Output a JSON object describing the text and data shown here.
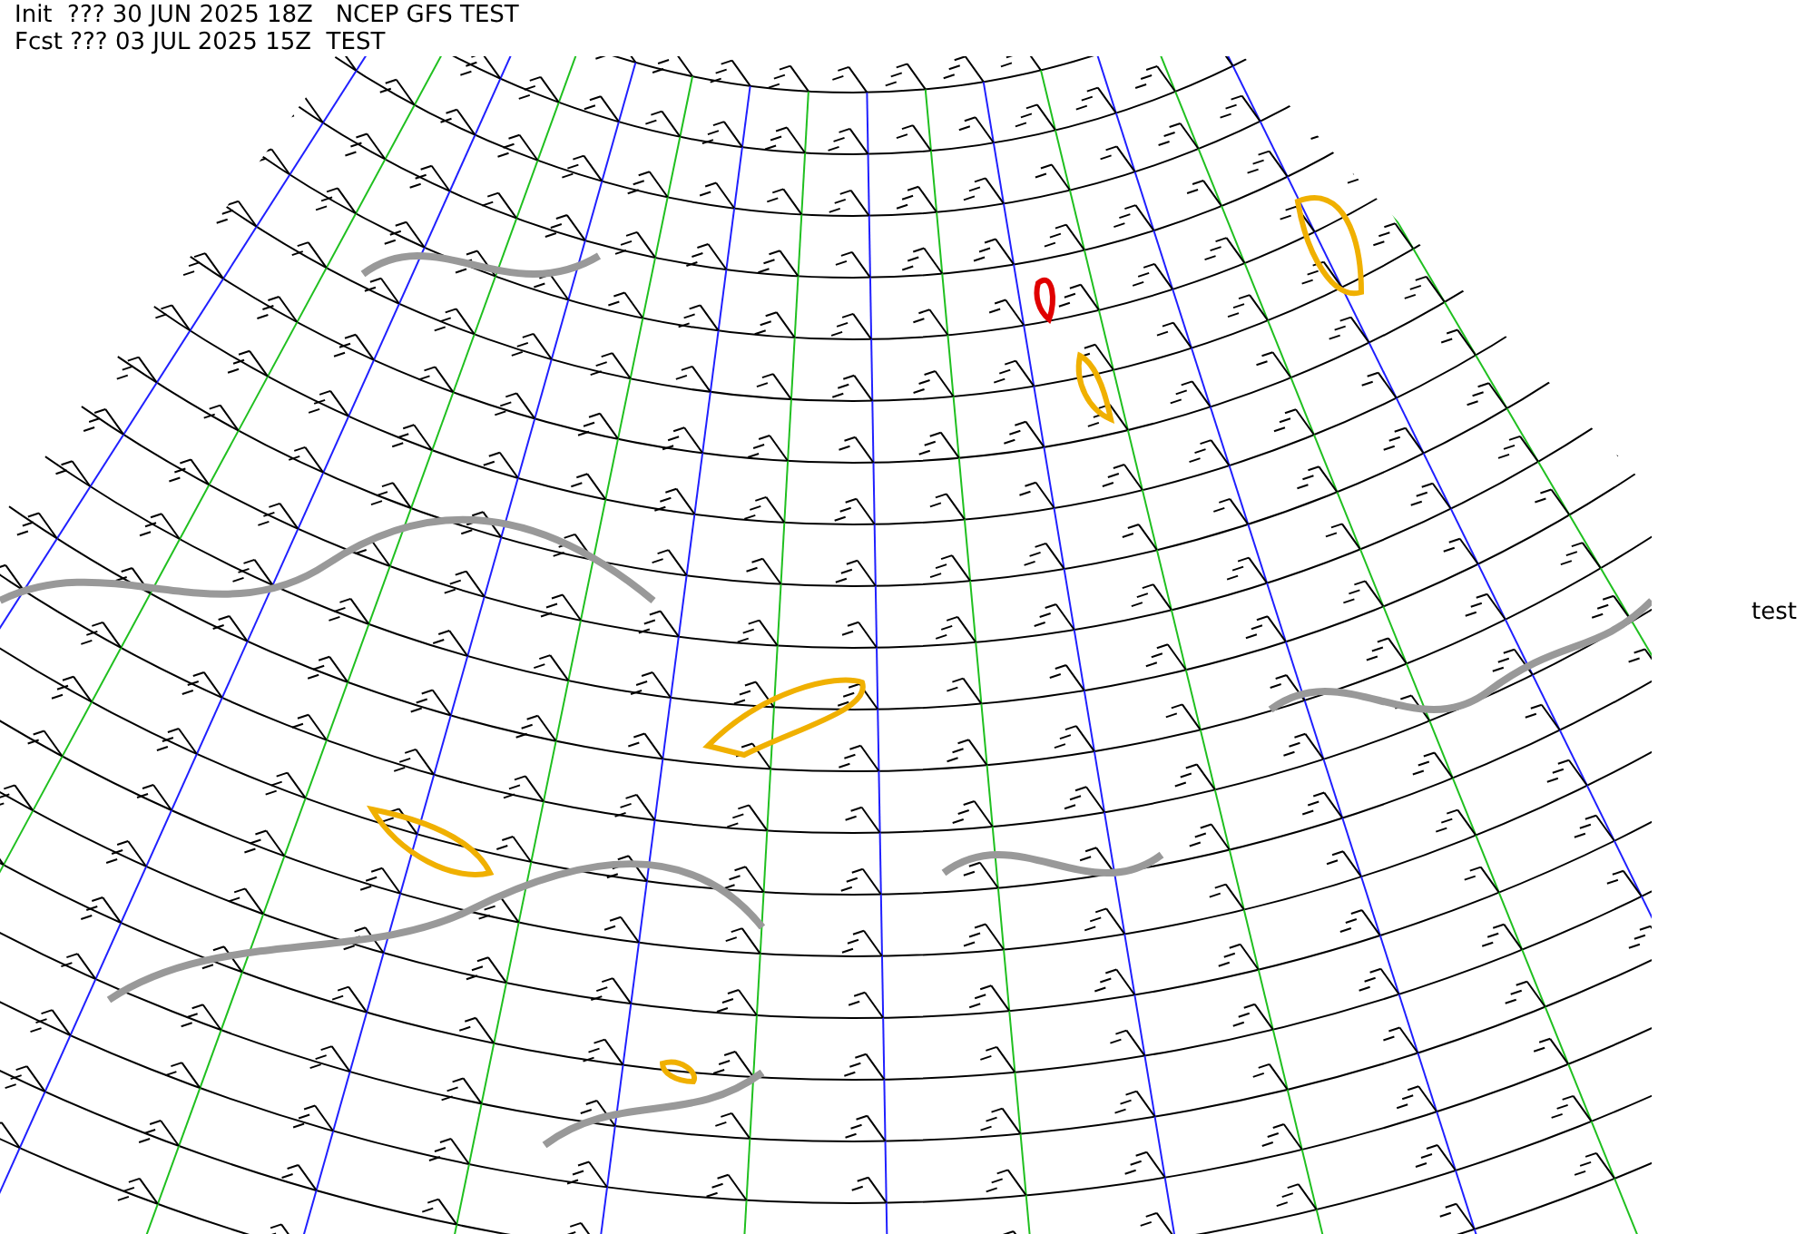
{
  "header": {
    "init_line": "Init  ??? 30 JUN 2025 18Z   NCEP GFS TEST",
    "forecast_line": "Fcst ??? 03 JUL 2025 15Z  TEST"
  },
  "side_label": "test"
}
